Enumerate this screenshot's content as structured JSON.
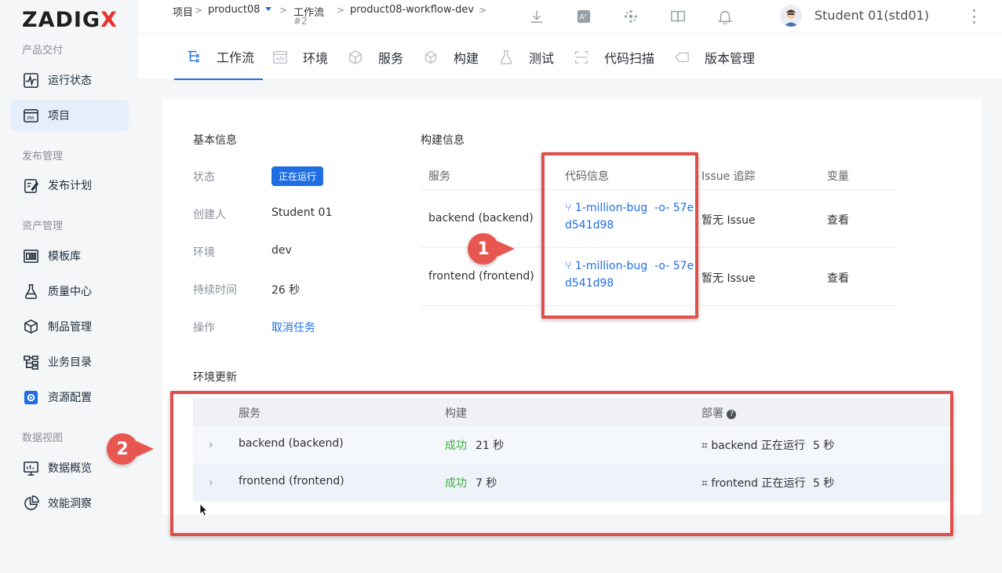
{
  "brand": {
    "logo_text": "ZADIG",
    "logo_x": "X",
    "accent": "#1f6fe3",
    "logo_x_color": "#e8322f"
  },
  "sidebar": {
    "sections": [
      {
        "label": "产品交付"
      },
      {
        "label": "发布管理"
      },
      {
        "label": "资产管理"
      },
      {
        "label": "数据视图"
      }
    ],
    "items": [
      {
        "label": "运行状态",
        "icon": "pulse-icon"
      },
      {
        "label": "项目",
        "icon": "project-pm-icon",
        "active": true
      },
      {
        "label": "发布计划",
        "icon": "release-plan-icon"
      },
      {
        "label": "模板库",
        "icon": "template-library-icon"
      },
      {
        "label": "质量中心",
        "icon": "flask-icon"
      },
      {
        "label": "制品管理",
        "icon": "artifact-box-icon"
      },
      {
        "label": "业务目录",
        "icon": "business-catalog-icon"
      },
      {
        "label": "资源配置",
        "icon": "resource-gear-icon"
      },
      {
        "label": "数据概览",
        "icon": "data-overview-icon"
      },
      {
        "label": "效能洞察",
        "icon": "pie-chart-icon"
      }
    ]
  },
  "header": {
    "breadcrumb": {
      "root": "项目",
      "project": "product08",
      "workflow_label": "工作流",
      "workflow_sub": "#2",
      "workflow_name": "product08-workflow-dev",
      "sep": ">"
    },
    "icons": [
      "download-icon",
      "translate-icon",
      "plugin-icon",
      "docs-book-icon",
      "bell-icon"
    ],
    "user": "Student 01(std01)"
  },
  "tabs": [
    {
      "label": "工作流",
      "icon": "workflow-icon",
      "active": true
    },
    {
      "label": "环境",
      "icon": "environment-code-icon"
    },
    {
      "label": "服务",
      "icon": "service-cube-icon"
    },
    {
      "label": "构建",
      "icon": "build-box-icon"
    },
    {
      "label": "测试",
      "icon": "test-flask-icon"
    },
    {
      "label": "代码扫描",
      "icon": "code-scan-icon"
    },
    {
      "label": "版本管理",
      "icon": "version-tag-icon"
    }
  ],
  "basic_info": {
    "title": "基本信息",
    "status_key": "状态",
    "status_val": "正在运行",
    "creator_key": "创建人",
    "creator_val": "Student 01",
    "env_key": "环境",
    "env_val": "dev",
    "duration_key": "持续时间",
    "duration_val": "26 秒",
    "action_key": "操作",
    "action_val": "取消任务"
  },
  "build_info": {
    "title": "构建信息",
    "headers": {
      "service": "服务",
      "code": "代码信息",
      "issue": "Issue 追踪",
      "vars": "变量"
    },
    "rows": [
      {
        "service": "backend (backend)",
        "branch": "1-million-bug",
        "commit_a": "57e",
        "commit_b": "d541d98",
        "issue": "暂无 Issue",
        "vars": "查看"
      },
      {
        "service": "frontend (frontend)",
        "branch": "1-million-bug",
        "commit_a": "57e",
        "commit_b": "d541d98",
        "issue": "暂无 Issue",
        "vars": "查看"
      }
    ]
  },
  "env_update": {
    "title": "环境更新",
    "headers": {
      "service": "服务",
      "build": "构建",
      "deploy": "部署"
    },
    "rows": [
      {
        "service": "backend (backend)",
        "build_status": "成功",
        "build_time": "21 秒",
        "deploy_text": "backend 正在运行",
        "deploy_time": "5 秒"
      },
      {
        "service": "frontend (frontend)",
        "build_status": "成功",
        "build_time": "7 秒",
        "deploy_text": "frontend 正在运行",
        "deploy_time": "5 秒"
      }
    ]
  },
  "annotations": {
    "callout_1": "1",
    "callout_2": "2",
    "highlight_color": "#e0504b"
  }
}
